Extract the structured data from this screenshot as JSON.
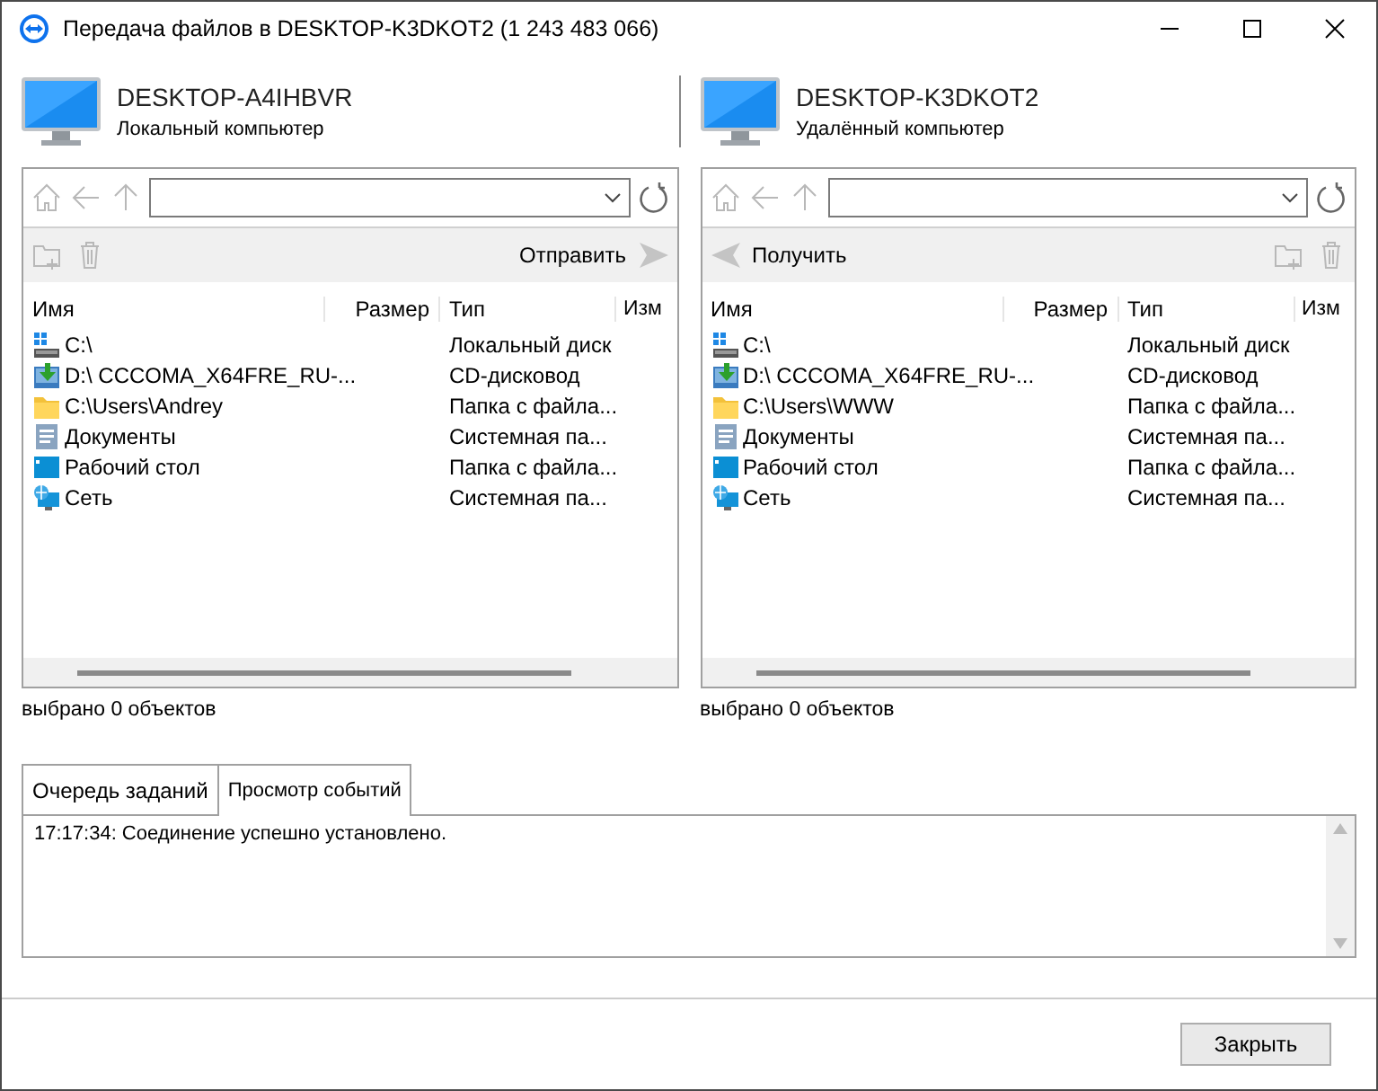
{
  "window": {
    "title": "Передача файлов в DESKTOP-K3DKOT2 (1 243 483 066)"
  },
  "panels": [
    {
      "computer": "DESKTOP-A4IHBVR",
      "role": "Локальный компьютер",
      "transfer": {
        "label": "Отправить",
        "kind": "send"
      },
      "columns": [
        "Имя",
        "Размер",
        "Тип",
        "Изм"
      ],
      "rows": [
        {
          "kind": "drive",
          "name": "C:\\",
          "type": "Локальный диск"
        },
        {
          "kind": "cd",
          "name": "D:\\  CCCOMA_X64FRE_RU-...",
          "type": "CD-дисковод"
        },
        {
          "kind": "folder",
          "name": "C:\\Users\\Andrey",
          "type": "Папка с файла..."
        },
        {
          "kind": "documents",
          "name": "Документы",
          "type": "Системная па..."
        },
        {
          "kind": "desktop",
          "name": "Рабочий стол",
          "type": "Папка с файла..."
        },
        {
          "kind": "network",
          "name": "Сеть",
          "type": "Системная па..."
        }
      ],
      "status": "выбрано 0 объектов"
    },
    {
      "computer": "DESKTOP-K3DKOT2",
      "role": "Удалённый компьютер",
      "transfer": {
        "label": "Получить",
        "kind": "receive"
      },
      "columns": [
        "Имя",
        "Размер",
        "Тип",
        "Изм"
      ],
      "rows": [
        {
          "kind": "drive",
          "name": "C:\\",
          "type": "Локальный диск"
        },
        {
          "kind": "cd",
          "name": "D:\\  CCCOMA_X64FRE_RU-...",
          "type": "CD-дисковод"
        },
        {
          "kind": "folder",
          "name": "C:\\Users\\WWW",
          "type": "Папка с файла..."
        },
        {
          "kind": "documents",
          "name": "Документы",
          "type": "Системная па..."
        },
        {
          "kind": "desktop",
          "name": "Рабочий стол",
          "type": "Папка с файла..."
        },
        {
          "kind": "network",
          "name": "Сеть",
          "type": "Системная па..."
        }
      ],
      "status": "выбрано 0 объектов"
    }
  ],
  "tabs": [
    {
      "label": "Очередь заданий",
      "selected": false
    },
    {
      "label": "Просмотр событий",
      "selected": true
    }
  ],
  "log": [
    "17:17:34: Соединение успешно установлено."
  ],
  "buttons": [
    "Закрыть"
  ]
}
